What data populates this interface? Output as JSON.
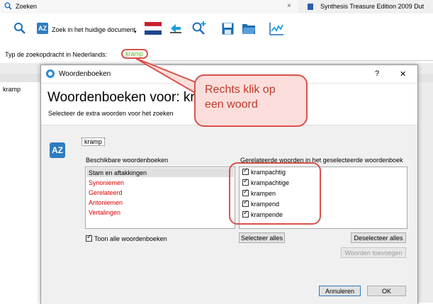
{
  "app": {
    "tab_icon": "zoom-icon",
    "tab_label": "Zoeken",
    "tab_close": "×",
    "second_tab_label": "Synthesis Treasure Edition 2009 Dut",
    "toolbar": {
      "search_doc_label": "Zoek in het huidige document",
      "icons": [
        "search-icon",
        "az-icon",
        "flag-nl-icon",
        "word-arrow-icon",
        "zoom-plus-icon",
        "save-icon",
        "folder-icon",
        "chart-icon"
      ]
    },
    "query_label": "Typ de zoekopdracht in Nederlands:",
    "query_value": "kramp",
    "list_first_item": "kramp"
  },
  "dialog": {
    "title": "Woordenboeken",
    "help": "?",
    "close": "✕",
    "heading": "Woordenboeken voor: kra",
    "subheading": "Selecteer de extra woorden voor het zoeken",
    "word_tag": "kramp",
    "left_label": "Beschikbare woordenboeken",
    "dictionaries": [
      {
        "label": "Stam en aftakkingen",
        "selected": true,
        "red": false
      },
      {
        "label": "Synoniemen",
        "selected": false,
        "red": true
      },
      {
        "label": "Gerelateerd",
        "selected": false,
        "red": true
      },
      {
        "label": "Antoniemen",
        "selected": false,
        "red": true
      },
      {
        "label": "Vertalingen",
        "selected": false,
        "red": true
      }
    ],
    "right_label": "Gerelateerde woorden in het geselecteerde woordenboek",
    "related_words": [
      "krampachtig",
      "krampachtige",
      "krampen",
      "krampend",
      "krampende"
    ],
    "show_all_label": "Toon alle woordenboeken",
    "select_all": "Selecteer alles",
    "deselect_all": "Deselecteer alles",
    "add_words": "Woorden toevoegen",
    "cancel": "Annuleren",
    "ok": "OK"
  },
  "annotation": {
    "text_line1": "Rechts klik op",
    "text_line2": "een woord"
  },
  "colors": {
    "highlight_red": "#d9524a",
    "dict_red": "#d80000",
    "accent_green": "#5ab52f"
  }
}
